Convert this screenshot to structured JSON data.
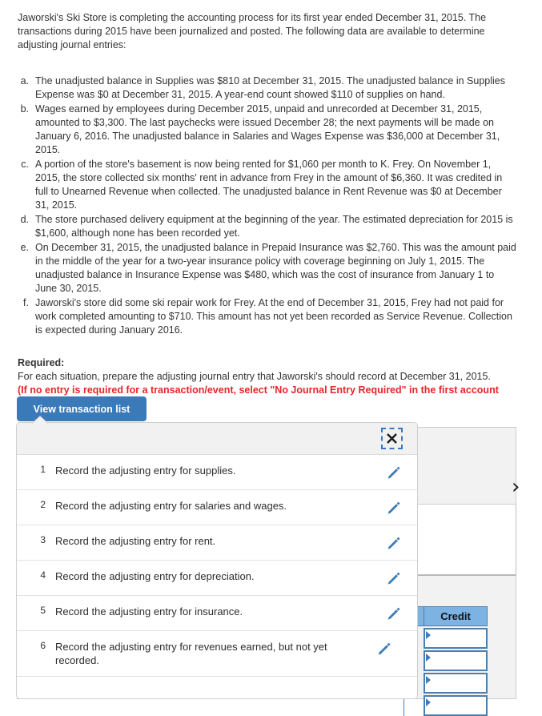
{
  "problem": {
    "intro": "Jaworski's Ski Store is completing the accounting process for its first year ended December 31, 2015. The transactions during 2015 have been journalized and posted. The following data are available to determine adjusting journal entries:",
    "situations": [
      {
        "letter": "a.",
        "text": "The unadjusted balance in Supplies was $810 at December 31, 2015. The unadjusted balance in Supplies Expense was $0 at December 31, 2015. A year-end count showed $110 of supplies on hand."
      },
      {
        "letter": "b.",
        "text": "Wages earned by employees during December 2015, unpaid and unrecorded at December 31, 2015, amounted to $3,300. The last paychecks were issued December 28; the next payments will be made on January 6, 2016. The unadjusted balance in Salaries and Wages Expense was $36,000 at December 31, 2015."
      },
      {
        "letter": "c.",
        "text": "A portion of the store's basement is now being rented for $1,060 per month to K. Frey. On November 1, 2015, the store collected six months' rent in advance from Frey in the amount of $6,360. It was credited in full to Unearned Revenue when collected. The unadjusted balance in Rent Revenue was $0 at December 31, 2015."
      },
      {
        "letter": "d.",
        "text": "The store purchased delivery equipment at the beginning of the year. The estimated depreciation for 2015 is $1,600, although none has been recorded yet."
      },
      {
        "letter": "e.",
        "text": "On December 31, 2015, the unadjusted balance in Prepaid Insurance was $2,760. This was the amount paid in the middle of the year for a two-year insurance policy with coverage beginning on July 1, 2015. The unadjusted balance in Insurance Expense was $480, which was the cost of insurance from January 1 to June 30, 2015."
      },
      {
        "letter": "f.",
        "text": "Jaworski's store did some ski repair work for Frey. At the end of December 31, 2015, Frey had not paid for work completed amounting to $710. This amount has not yet been recorded as Service Revenue. Collection is expected during January 2016."
      }
    ],
    "required_title": "Required:",
    "required_line": "For each situation, prepare the adjusting journal entry that Jaworski's should record at December 31, 2015.",
    "required_note": "(If no entry is required for a transaction/event, select \"No Journal Entry Required\" in the first account field.)"
  },
  "view_button": {
    "label": "View transaction list"
  },
  "popover": {
    "close_icon": "close-icon",
    "rows": [
      {
        "num": "1",
        "text": "Record the adjusting entry for supplies.",
        "edit_icon": "pencil-icon"
      },
      {
        "num": "2",
        "text": "Record the adjusting entry for salaries and wages.",
        "edit_icon": "pencil-icon"
      },
      {
        "num": "3",
        "text": "Record the adjusting entry for rent.",
        "edit_icon": "pencil-icon"
      },
      {
        "num": "4",
        "text": "Record the adjusting entry for depreciation.",
        "edit_icon": "pencil-icon"
      },
      {
        "num": "5",
        "text": "Record the adjusting entry for insurance.",
        "edit_icon": "pencil-icon"
      },
      {
        "num": "6",
        "text": "Record the adjusting entry for revenues earned, but not yet recorded.",
        "edit_icon": "pencil-icon"
      }
    ]
  },
  "journal_table": {
    "credit_header": "Credit",
    "rows": [
      {
        "value": ""
      },
      {
        "value": ""
      },
      {
        "value": ""
      },
      {
        "value": ""
      }
    ]
  },
  "background": {
    "next_chevron": "›"
  },
  "colors": {
    "button_blue": "#3a7ab8",
    "note_red": "#e8242a",
    "table_header_blue": "#7db3e3",
    "cell_border_blue": "#4a7fb0",
    "pencil_blue": "#3f7cb5",
    "focus_ring_blue": "#3a78c2"
  }
}
